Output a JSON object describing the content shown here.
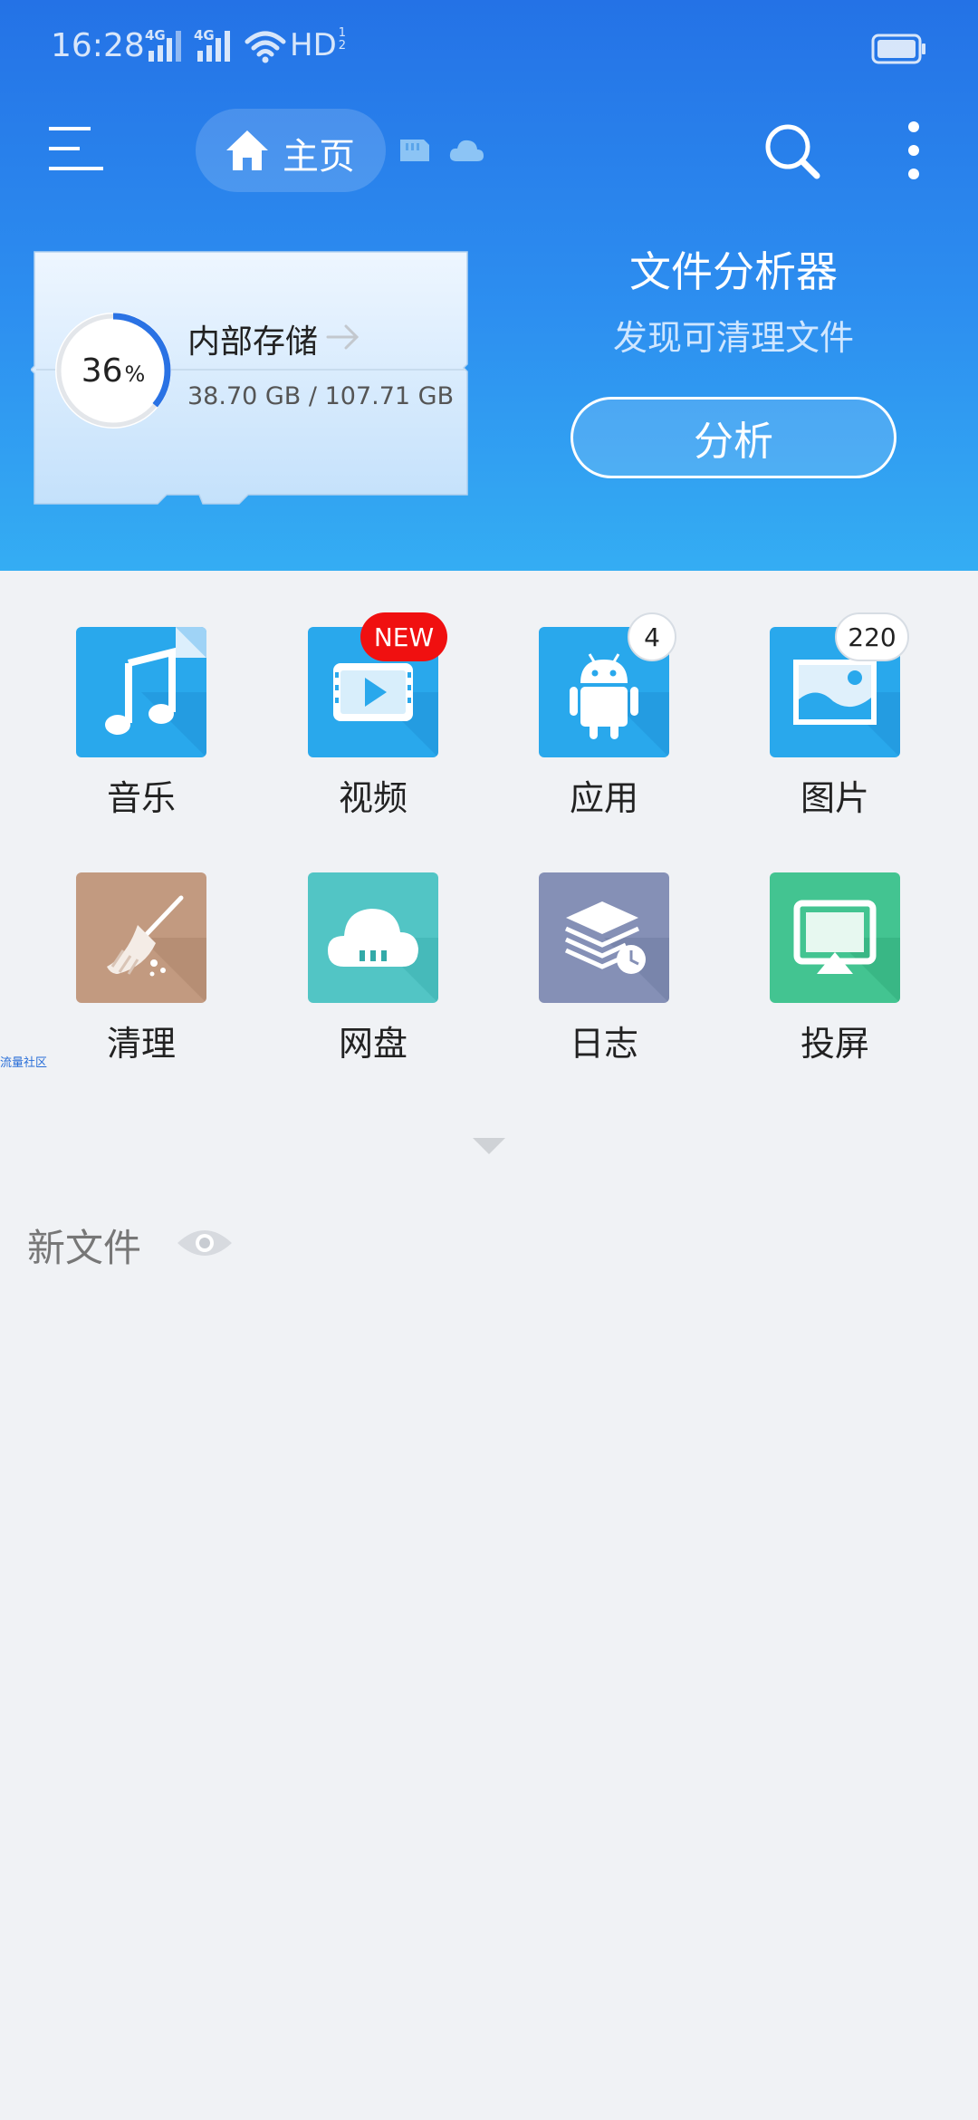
{
  "status_bar": {
    "time": "16:28",
    "signal1": "4G",
    "signal2": "4G",
    "hd": "HD",
    "hd_sub": "1 2"
  },
  "toolbar": {
    "home_label": "主页"
  },
  "storage": {
    "percent": "36",
    "percent_unit": "%",
    "percent_value": 0.36,
    "title": "内部存储",
    "usage": "38.70 GB / 107.71 GB"
  },
  "analyzer": {
    "title": "文件分析器",
    "subtitle": "发现可清理文件",
    "button": "分析"
  },
  "categories": [
    {
      "label": "音乐",
      "icon": "music-icon",
      "color": "#29a8ec"
    },
    {
      "label": "视频",
      "icon": "video-icon",
      "color": "#29a8ec",
      "badge": "NEW"
    },
    {
      "label": "应用",
      "icon": "android-icon",
      "color": "#29a8ec",
      "badge": "4"
    },
    {
      "label": "图片",
      "icon": "image-icon",
      "color": "#29a8ec",
      "badge": "220"
    },
    {
      "label": "清理",
      "icon": "broom-icon",
      "color": "#c29a80"
    },
    {
      "label": "网盘",
      "icon": "cloud-storage-icon",
      "color": "#52c5c5"
    },
    {
      "label": "日志",
      "icon": "log-icon",
      "color": "#8590b6"
    },
    {
      "label": "投屏",
      "icon": "cast-icon",
      "color": "#43c491"
    }
  ],
  "watermark": "流量社区",
  "new_files": {
    "title": "新文件"
  },
  "colors": {
    "header_top": "#2472e6",
    "header_bottom": "#34adf3",
    "accent_ring": "#2a72e4",
    "badge_red": "#f01010",
    "background": "#f0f2f5"
  }
}
